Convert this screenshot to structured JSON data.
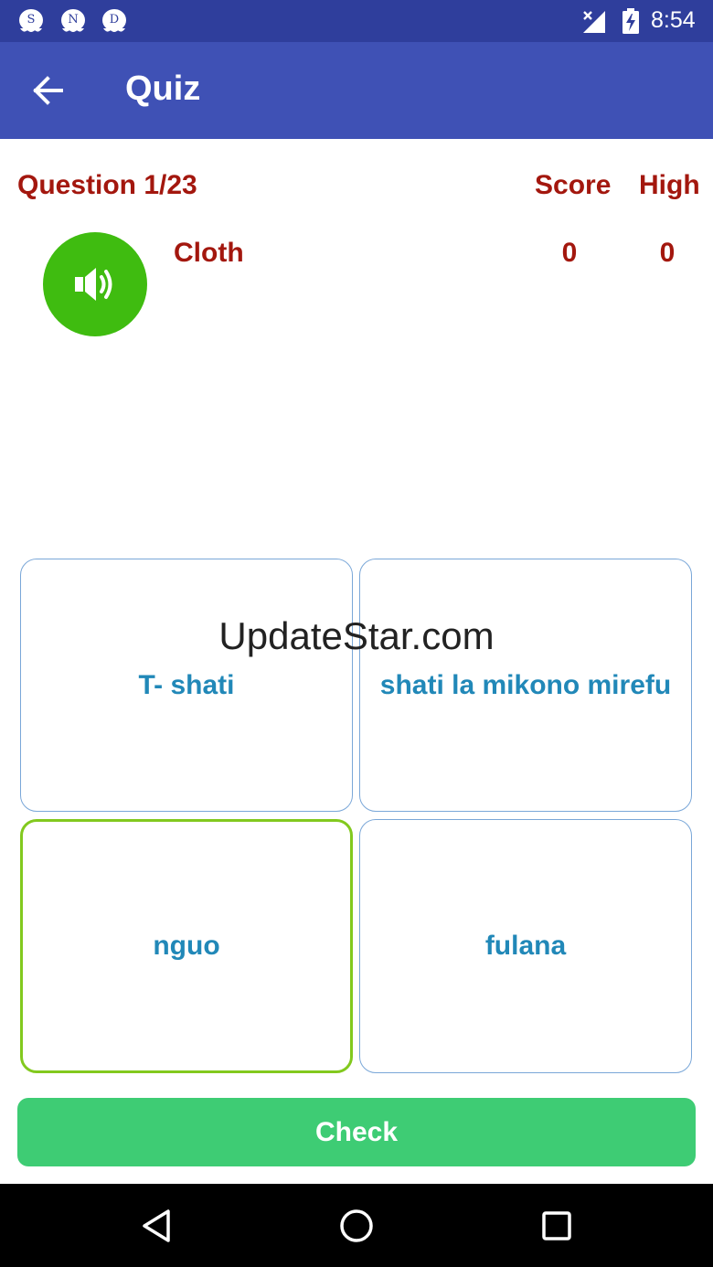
{
  "status_bar": {
    "notifications": [
      {
        "letter": "S",
        "icon": "notification-s-icon"
      },
      {
        "letter": "N",
        "icon": "notification-n-icon"
      },
      {
        "letter": "D",
        "icon": "notification-d-icon"
      }
    ],
    "time": "8:54"
  },
  "app_bar": {
    "title": "Quiz",
    "back_icon": "arrow-left-icon"
  },
  "quiz": {
    "question_label": "Question 1/23",
    "score_label": "Score",
    "high_label": "High",
    "word": "Cloth",
    "score": "0",
    "high": "0",
    "options": [
      {
        "text": "T- shati",
        "selected": false
      },
      {
        "text": "shati la mikono mirefu",
        "selected": false
      },
      {
        "text": "nguo",
        "selected": true
      },
      {
        "text": "fulana",
        "selected": false
      }
    ],
    "check_label": "Check"
  },
  "watermark": "UpdateStar.com",
  "colors": {
    "status_bar": "#2f3e9c",
    "app_bar": "#3f51b5",
    "text_red": "#a3170e",
    "option_text": "#2188b8",
    "speaker": "#3fbc10",
    "check": "#3ecc74",
    "selected_border": "#82c91e"
  }
}
